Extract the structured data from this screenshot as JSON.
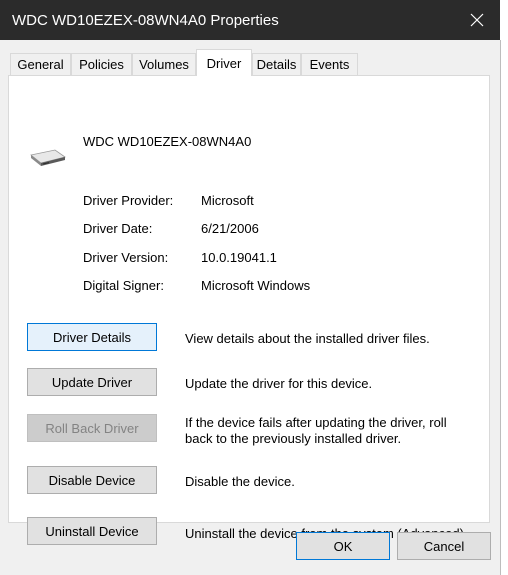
{
  "window": {
    "title": "WDC WD10EZEX-08WN4A0 Properties"
  },
  "tabs": [
    {
      "label": "General"
    },
    {
      "label": "Policies"
    },
    {
      "label": "Volumes"
    },
    {
      "label": "Driver",
      "active": true
    },
    {
      "label": "Details"
    },
    {
      "label": "Events"
    }
  ],
  "device": {
    "name": "WDC WD10EZEX-08WN4A0",
    "icon": "hard-drive-icon"
  },
  "info": [
    {
      "label": "Driver Provider:",
      "value": "Microsoft"
    },
    {
      "label": "Driver Date:",
      "value": "6/21/2006"
    },
    {
      "label": "Driver Version:",
      "value": "10.0.19041.1"
    },
    {
      "label": "Digital Signer:",
      "value": "Microsoft Windows"
    }
  ],
  "actions": [
    {
      "button": "Driver Details",
      "description": "View details about the installed driver files."
    },
    {
      "button": "Update Driver",
      "description": "Update the driver for this device."
    },
    {
      "button": "Roll Back Driver",
      "description": "If the device fails after updating the driver, roll back to the previously installed driver.",
      "disabled": true
    },
    {
      "button": "Disable Device",
      "description": "Disable the device."
    },
    {
      "button": "Uninstall Device",
      "description": "Uninstall the device from the system (Advanced)."
    }
  ],
  "footer": {
    "ok": "OK",
    "cancel": "Cancel"
  },
  "colors": {
    "titlebar": "#2b2b2b",
    "focus": "#0078d7",
    "dialog": "#f0f0f0"
  }
}
